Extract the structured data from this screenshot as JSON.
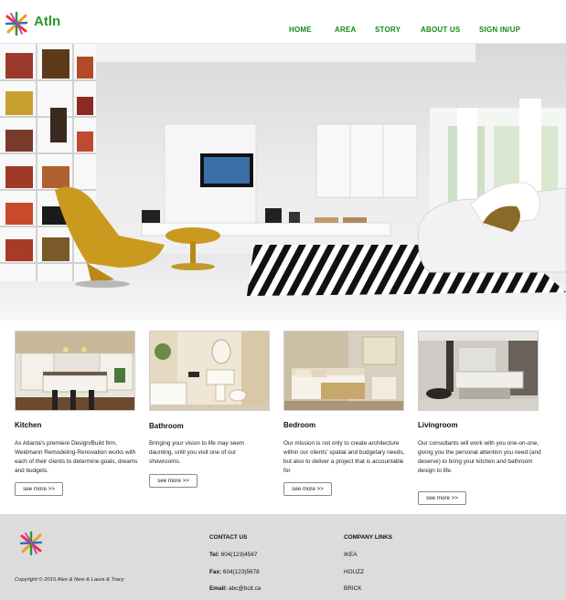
{
  "header": {
    "logo_text": "Atln",
    "nav": [
      "HOME",
      "AREA",
      "STORY",
      "ABOUT US",
      "SIGN IN/UP"
    ]
  },
  "colors": {
    "brand_green": "#158a15",
    "footer_bg": "#dcdcdc"
  },
  "cards": [
    {
      "title": "Kitchen",
      "text": "As Atlanta's premiere Design/Build firm, Weidmann Remodeling-Renovation works with each of their clients to determine goals, dreams and budgets.",
      "button": "see more >>"
    },
    {
      "title": "Bathroom",
      "text": "Bringing your vision to life may seem daunting, until you visit one of our showrooms.",
      "button": "see more >>"
    },
    {
      "title": "Bedroom",
      "text": "Our mission is not only to create architecture within our clients' spatial and budgetary needs, but also to deliver a project that is accountable for",
      "button": "see more >>"
    },
    {
      "title": "Livingroom",
      "text": "Our consultants will work with you one-on-one, giving you the personal attention you need (and deserve) to bring your kitchen and bathroom design to life.",
      "button": "see more >>"
    }
  ],
  "footer": {
    "copyright": "Copyright © 2015 Alex & New & Laura & Tracy",
    "contact": {
      "heading": "CONTACT US",
      "tel_label": "Tel:",
      "tel": "604(123)4567",
      "fax_label": "Fax:",
      "fax": "604(123)5678",
      "email_label": "Email:",
      "email": "abc@bcit.ca"
    },
    "links": {
      "heading": "COMPANY LINKS",
      "items": [
        "IKEA",
        "HOUZZ",
        "BRICK"
      ]
    }
  }
}
